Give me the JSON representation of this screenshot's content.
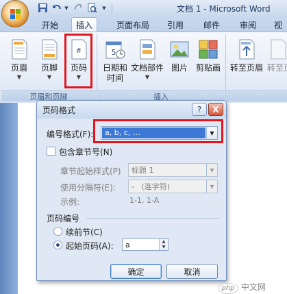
{
  "window": {
    "title": "文档 1 - Microsoft Word"
  },
  "quick_access": {
    "icons": [
      "save-icon",
      "undo-icon",
      "redo-icon",
      "print-preview-icon",
      "customize-icon"
    ]
  },
  "tabs": [
    {
      "label": "开始",
      "active": false
    },
    {
      "label": "插入",
      "active": true
    },
    {
      "label": "页面布局",
      "active": false
    },
    {
      "label": "引用",
      "active": false
    },
    {
      "label": "邮件",
      "active": false
    },
    {
      "label": "审阅",
      "active": false
    },
    {
      "label": "视"
    }
  ],
  "ribbon": {
    "header_footer_group": {
      "title": "页眉和页脚",
      "buttons": [
        {
          "label": "页眉",
          "icon": "header-icon"
        },
        {
          "label": "页脚",
          "icon": "footer-icon"
        },
        {
          "label": "页码",
          "icon": "page-number-icon"
        }
      ]
    },
    "insert_group": {
      "title": "插入",
      "buttons": [
        {
          "label": "日期和\n时间",
          "icon": "calendar-icon"
        },
        {
          "label": "文档部件",
          "icon": "document-parts-icon"
        },
        {
          "label": "图片",
          "icon": "picture-icon"
        },
        {
          "label": "剪贴画",
          "icon": "clipart-icon"
        }
      ]
    },
    "convert_group": {
      "buttons": [
        {
          "label": "转至页眉",
          "icon": "goto-header-icon"
        },
        {
          "label": "转至页"
        }
      ]
    }
  },
  "dialog": {
    "title": "页码格式",
    "help_label": "?",
    "close_label": "X",
    "number_format": {
      "label": "编号格式(F):",
      "value": "a, b, c, …"
    },
    "include_chapter": {
      "label": "包含章节号(N)",
      "checked": false
    },
    "chapter_style": {
      "label": "章节起始样式(P)",
      "value": "标题 1"
    },
    "separator": {
      "label": "使用分隔符(E):",
      "value": "-   (连字符)"
    },
    "example": {
      "label": "示例:",
      "value": "1-1, 1-A"
    },
    "page_numbering": {
      "label": "页码编号",
      "continue_option": {
        "label": "续前节(C)",
        "selected": false
      },
      "start_at_option": {
        "label": "起始页码(A):",
        "selected": true
      },
      "start_at_value": "a"
    },
    "ok_label": "确定",
    "cancel_label": "取消"
  },
  "watermark": {
    "logo_text": "php",
    "text": "中文网"
  },
  "colors": {
    "highlight_red": "#e1161c",
    "ribbon_blue": "#c9d9ee",
    "selection_blue": "#3c79d6"
  }
}
